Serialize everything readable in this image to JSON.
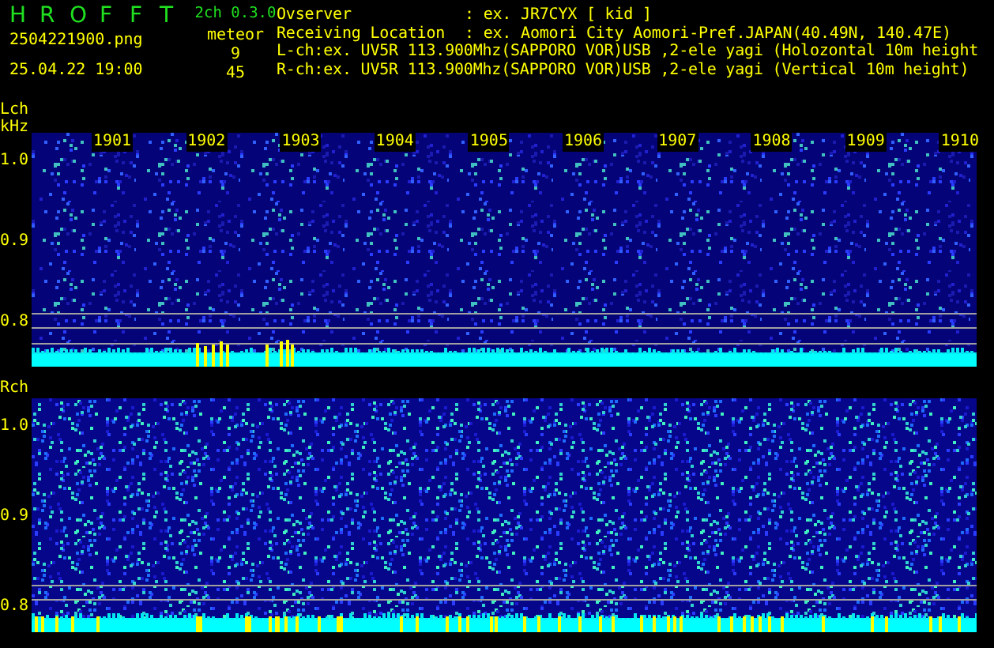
{
  "header": {
    "logo": [
      "H",
      "R",
      "O",
      "F",
      "F",
      "T"
    ],
    "version": "2ch 0.3.0",
    "filename": "2504221900.png",
    "datetime": "25.04.22 19:00",
    "meteor_label": "meteor",
    "counts": [
      "9",
      "45"
    ],
    "info": [
      {
        "kind": "field",
        "label": "Ovserver",
        "value": ": ex. JR7CYX [ kid ]"
      },
      {
        "kind": "field",
        "label": "Receiving Location",
        "value": ": ex. Aomori City Aomori-Pref.JAPAN(40.49N, 140.47E)"
      },
      {
        "kind": "line",
        "text": "L-ch:ex. UV5R 113.900Mhz(SAPPORO VOR)USB ,2-ele yagi (Holozontal 10m height"
      },
      {
        "kind": "line",
        "text": "R-ch:ex. UV5R 113.900Mhz(SAPPORO VOR)USB ,2-ele yagi (Vertical 10m height)"
      }
    ]
  },
  "channels": [
    {
      "label": "Lch",
      "unit": "kHz",
      "x_ticks": [
        "1901",
        "1902",
        "1903",
        "1904",
        "1905",
        "1906",
        "1907",
        "1908",
        "1909",
        "1910"
      ],
      "y_ticks": [
        "1.0",
        "0.9",
        "0.8"
      ]
    },
    {
      "label": "Rch",
      "y_ticks": [
        "1.0",
        "0.9",
        "0.8"
      ]
    }
  ]
}
